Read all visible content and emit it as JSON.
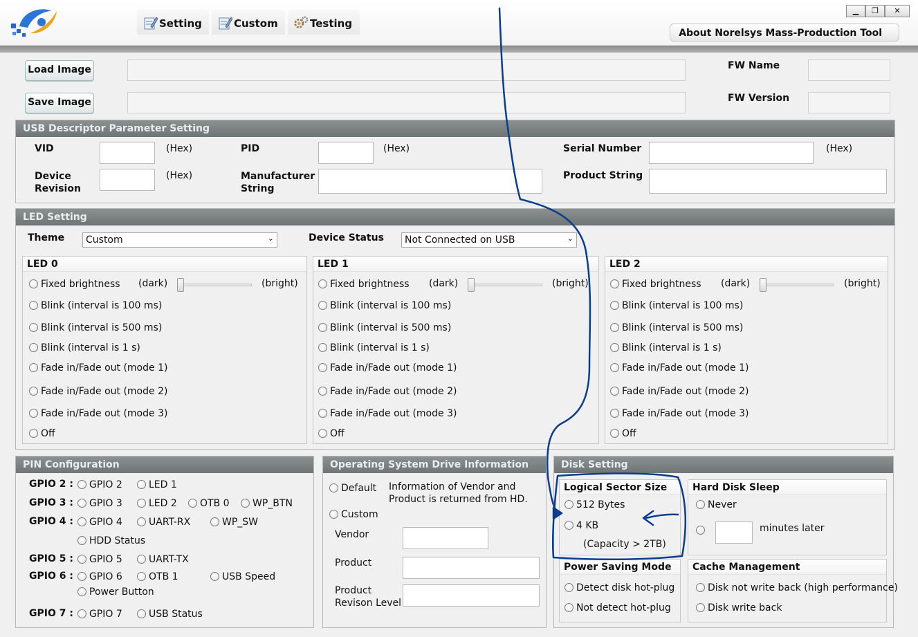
{
  "tabs": [
    "Setting",
    "Custom",
    "Testing"
  ],
  "about": "About Norelsys Mass-Production Tool",
  "window_buttons": [
    "minimize-icon",
    "restore-icon",
    "close-icon"
  ],
  "window_glyphs": [
    "▁",
    "❐",
    "✕"
  ],
  "image": {
    "load_label": "Load Image",
    "save_label": "Save Image",
    "fw_name": "FW Name",
    "fw_version": "FW Version"
  },
  "usb": {
    "title": "USB Descriptor Parameter Setting",
    "vid": "VID",
    "pid": "PID",
    "serial": "Serial Number",
    "device_revision": "Device Revision",
    "manufacturer": "Manufacturer String",
    "product_string": "Product String",
    "hex": "(Hex)"
  },
  "led": {
    "title": "LED Setting",
    "theme_label": "Theme",
    "theme_value": "Custom",
    "status_label": "Device Status",
    "status_value": "Not Connected on USB",
    "groups": [
      "LED 0",
      "LED 1",
      "LED 2"
    ],
    "dark": "(dark)",
    "bright": "(bright)",
    "options": [
      "Fixed brightness",
      "Blink (interval is 100 ms)",
      "Blink (interval is 500 ms)",
      "Blink (interval is 1 s)",
      "Fade in/Fade out (mode 1)",
      "Fade in/Fade out (mode 2)",
      "Fade in/Fade out (mode 3)",
      "Off"
    ]
  },
  "pin": {
    "title": "PIN Configuration",
    "rows": [
      {
        "label": "GPIO 2 :",
        "options": [
          "GPIO 2",
          "LED 1"
        ]
      },
      {
        "label": "GPIO 3 :",
        "options": [
          "GPIO 3",
          "LED 2",
          "OTB 0",
          "WP_BTN"
        ]
      },
      {
        "label": "GPIO 4 :",
        "options": [
          "GPIO 4",
          "UART-RX",
          "WP_SW",
          "HDD Status"
        ]
      },
      {
        "label": "GPIO 5 :",
        "options": [
          "GPIO 5",
          "UART-TX"
        ]
      },
      {
        "label": "GPIO 6 :",
        "options": [
          "GPIO 6",
          "OTB 1",
          "USB Speed",
          "Power Button"
        ]
      },
      {
        "label": "GPIO 7 :",
        "options": [
          "GPIO 7",
          "USB Status"
        ]
      }
    ]
  },
  "os": {
    "title": "Operating System Drive Information",
    "default": "Default",
    "info_line1": "Information of Vendor and",
    "info_line2": "Product is returned from HD.",
    "custom": "Custom",
    "vendor": "Vendor",
    "product": "Product",
    "revision_line1": "Product",
    "revision_line2": "Revison Level"
  },
  "disk": {
    "title": "Disk Setting",
    "sector_title": "Logical Sector Size",
    "sector_512": "512 Bytes",
    "sector_4k": "4 KB",
    "capacity": "(Capacity > 2TB)",
    "sleep_title": "Hard Disk Sleep",
    "never": "Never",
    "minutes": "minutes later",
    "power_title": "Power Saving Mode",
    "detect": "Detect disk hot-plug",
    "not_detect": "Not detect hot-plug",
    "cache_title": "Cache Management",
    "no_write_back": "Disk not write back (high performance)",
    "write_back": "Disk write back"
  },
  "annotation_color": "#0a3d8f"
}
